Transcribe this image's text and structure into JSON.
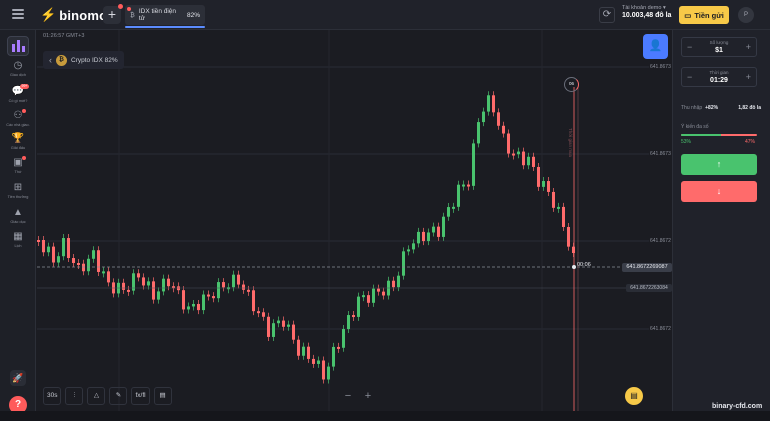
{
  "header": {
    "logo_text": "binomo",
    "asset_tab": {
      "label": "IDX tiền điện tử",
      "payout": "82%"
    },
    "account": {
      "label": "Tài khoản demo",
      "balance": "10.003,48 đô la"
    },
    "deposit_label": "Tiền gửi",
    "avatar_letter": "P"
  },
  "sidebar": {
    "items": [
      {
        "label": "Giao dịch",
        "icon": "clock-icon",
        "glyph": "◷"
      },
      {
        "label": "Có gì mới?",
        "icon": "chat-icon",
        "glyph": "💬",
        "badge": "99+"
      },
      {
        "label": "Các nhà giao.",
        "icon": "traders-icon",
        "glyph": "⚇",
        "dot": true
      },
      {
        "label": "Giải đấu",
        "icon": "trophy-icon",
        "glyph": "🏆"
      },
      {
        "label": "Thứ",
        "icon": "bag-icon",
        "glyph": "▣",
        "dot": true
      },
      {
        "label": "Tiền thưởng",
        "icon": "gift-icon",
        "glyph": "⊞"
      },
      {
        "label": "Giáo dục",
        "icon": "education-icon",
        "glyph": "▲"
      },
      {
        "label": "Lịch",
        "icon": "calendar-icon",
        "glyph": "▦"
      }
    ]
  },
  "chart_area": {
    "clock": "01:26:57 GMT+3",
    "asset_chip": "Crypto IDX 82%",
    "timer": "00:06",
    "ring_label": "06",
    "vertical_text": "Thời gian mua",
    "price_tag": "641.8672269087",
    "price_tag_secondary": "641.8672263084",
    "toolbar": {
      "timeframe": "30s",
      "indicators": "fx/fl"
    },
    "y_ticks": [
      "641.8673",
      "641.8673",
      "641.8672",
      "641.8672"
    ]
  },
  "right_panel": {
    "amount": {
      "caption": "Số lượng",
      "value": "$1"
    },
    "time": {
      "caption": "Thời gian",
      "value": "01:29"
    },
    "payout": {
      "label": "Thu nhập",
      "percent": "+82%",
      "amount": "1,82 đô la"
    },
    "sentiment": {
      "label": "Ý kiến đa số",
      "up": "53%",
      "down": "47%",
      "up_fraction": 0.53
    }
  },
  "colors": {
    "up": "#49c36e",
    "down": "#ff6b6b",
    "accent": "#f7c948",
    "brand_blue": "#4b7bff"
  },
  "watermark": "binary-cfd.com"
}
